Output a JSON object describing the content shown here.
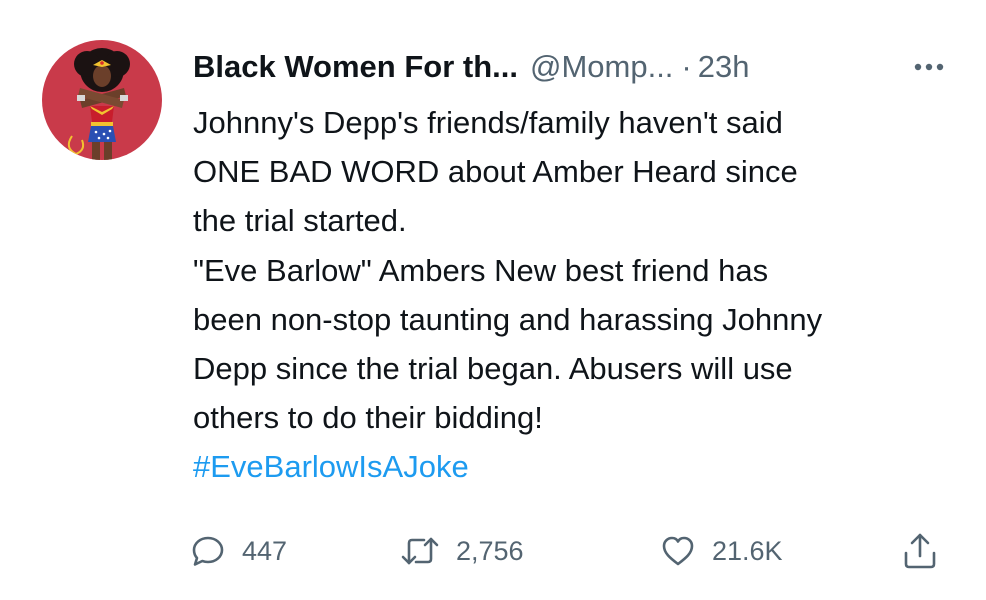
{
  "tweet": {
    "author": {
      "display_name": "Black Women For th...",
      "handle": "@Momp...",
      "separator": "·",
      "timestamp": "23h"
    },
    "body_lines": [
      "Johnny's Depp's friends/family haven't said",
      "ONE BAD WORD about Amber Heard since",
      "the trial started.",
      "\"Eve Barlow\" Ambers New best friend has",
      "been non-stop taunting and harassing Johnny",
      "Depp since the trial began. Abusers will use",
      "others to do their bidding!"
    ],
    "hashtag": "#EveBarlowIsAJoke",
    "stats": {
      "replies": "447",
      "retweets": "2,756",
      "likes": "21.6K"
    }
  },
  "icons": {
    "more": "more-horizontal-icon",
    "reply": "reply-bubble-icon",
    "retweet": "retweet-arrows-icon",
    "like": "heart-outline-icon",
    "share": "share-upload-icon"
  },
  "colors": {
    "text": "#0f1419",
    "secondary": "#536471",
    "link": "#1d9bf0",
    "avatar_background": "#c93a4a"
  }
}
